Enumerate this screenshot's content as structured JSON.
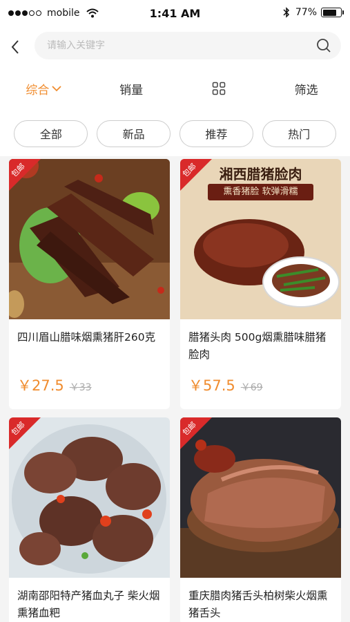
{
  "status_bar": {
    "carrier": "mobile",
    "time": "1:41 AM",
    "battery": "77%",
    "battery_level": 0.77
  },
  "search": {
    "placeholder": "请输入关键字",
    "value": ""
  },
  "sort_bar": {
    "items": [
      {
        "label": "综合",
        "active": true
      },
      {
        "label": "销量",
        "active": false
      },
      {
        "label": "",
        "icon": "grid-view-icon",
        "active": false
      },
      {
        "label": "筛选",
        "active": false
      }
    ]
  },
  "tags": [
    "全部",
    "新品",
    "推荐",
    "热门"
  ],
  "products": [
    {
      "badge": "包邮",
      "title": "四川眉山腊味烟熏猪肝260克",
      "price": "￥27.5",
      "old_price": "￥33",
      "image_caption": ""
    },
    {
      "badge": "包邮",
      "title": "腊猪头肉 500g烟熏腊味腊猪脸肉",
      "price": "￥57.5",
      "old_price": "￥69",
      "image_caption": "湘西腊猪脸肉",
      "image_subcaption": "熏香猪脸 软弹滑糯"
    },
    {
      "badge": "包邮",
      "title": "湖南邵阳特产猪血丸子 柴火烟熏猪血粑",
      "price": "",
      "old_price": ""
    },
    {
      "badge": "包邮",
      "title": "重庆腊肉猪舌头柏树柴火烟熏猪舌头",
      "price": "",
      "old_price": ""
    }
  ],
  "colors": {
    "accent": "#f08c2e",
    "badge": "#d92a2a"
  }
}
